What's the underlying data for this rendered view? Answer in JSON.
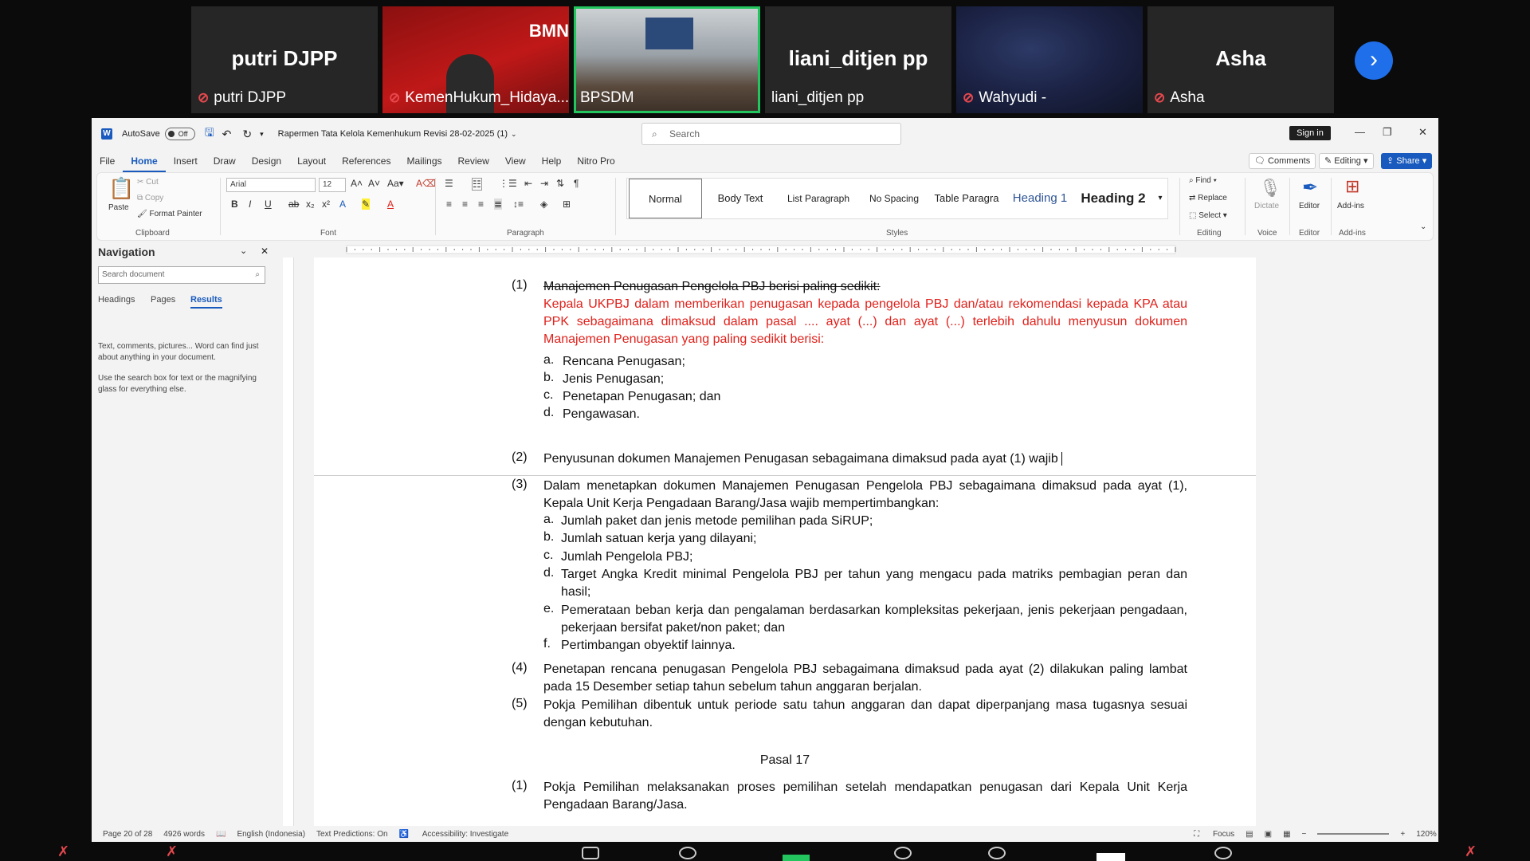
{
  "participants": [
    {
      "big_name": "putri DJPP",
      "caption": "putri DJPP",
      "muted": true,
      "kind": "name"
    },
    {
      "big_name": "",
      "caption": "KemenHukum_Hidaya...",
      "muted": true,
      "kind": "video-red",
      "overlay": "BMN"
    },
    {
      "big_name": "",
      "caption": "BPSDM",
      "muted": false,
      "kind": "video-room"
    },
    {
      "big_name": "liani_ditjen pp",
      "caption": "liani_ditjen pp",
      "muted": false,
      "kind": "name"
    },
    {
      "big_name": "",
      "caption": "Wahyudi -",
      "muted": true,
      "kind": "video-blur"
    },
    {
      "big_name": "Asha",
      "caption": "Asha",
      "muted": true,
      "kind": "name"
    }
  ],
  "titlebar": {
    "autosave": "AutoSave",
    "toggle": "Off",
    "doc_title": "Rapermen Tata Kelola Kemenhukum Revisi 28-02-2025 (1)",
    "search_placeholder": "Search",
    "signin": "Sign in"
  },
  "menu": [
    "File",
    "Home",
    "Insert",
    "Draw",
    "Design",
    "Layout",
    "References",
    "Mailings",
    "Review",
    "View",
    "Help",
    "Nitro Pro"
  ],
  "menu_right": {
    "comments": "Comments",
    "editing": "Editing",
    "share": "Share"
  },
  "ribbon": {
    "paste": "Paste",
    "cut": "Cut",
    "copy": "Copy",
    "format_painter": "Format Painter",
    "font_name": "Arial",
    "font_size": "12",
    "groups": {
      "clipboard": "Clipboard",
      "font": "Font",
      "paragraph": "Paragraph",
      "styles": "Styles",
      "editing": "Editing",
      "voice": "Voice",
      "editor": "Editor",
      "addins": "Add-ins"
    },
    "styles": [
      "Normal",
      "Body Text",
      "List Paragraph",
      "No Spacing",
      "Table Paragra",
      "Heading 1",
      "Heading 2"
    ],
    "find": "Find",
    "replace": "Replace",
    "select": "Select",
    "dictate": "Dictate",
    "editor": "Editor",
    "addins": "Add-ins"
  },
  "navigation": {
    "title": "Navigation",
    "search_placeholder": "Search document",
    "tabs": [
      "Headings",
      "Pages",
      "Results"
    ],
    "help1": "Text, comments, pictures... Word can find just about anything in your document.",
    "help2": "Use the search box for text or the magnifying glass for everything else."
  },
  "document": {
    "p1_num": "(1)",
    "p1_struck": "Manajemen Penugasan Pengelola PBJ berisi paling sedikit:",
    "p1_red": "Kepala UKPBJ dalam memberikan penugasan kepada pengelola PBJ dan/atau rekomendasi kepada KPA atau PPK sebagaimana dimaksud dalam pasal .... ayat (...) dan ayat (...)  terlebih dahulu menyusun dokumen Manajemen Penugasan yang paling sedikit berisi:",
    "list1": [
      {
        "m": "a.",
        "t": "Rencana Penugasan;"
      },
      {
        "m": "b.",
        "t": "Jenis Penugasan;"
      },
      {
        "m": "c.",
        "t": "Penetapan Penugasan; dan"
      },
      {
        "m": "d.",
        "t": "Pengawasan."
      }
    ],
    "p2_num": "(2)",
    "p2": "Penyusunan dokumen Manajemen Penugasan sebagaimana dimaksud pada ayat (1) wajib",
    "p3_num": "(3)",
    "p3": "Dalam menetapkan dokumen Manajemen Penugasan Pengelola PBJ sebagaimana dimaksud pada ayat (1), Kepala Unit Kerja Pengadaan Barang/Jasa wajib mempertimbangkan:",
    "list3": [
      {
        "m": "a.",
        "t": "Jumlah paket dan jenis metode pemilihan pada SiRUP;"
      },
      {
        "m": "b.",
        "t": "Jumlah satuan kerja yang dilayani;"
      },
      {
        "m": "c.",
        "t": "Jumlah Pengelola PBJ;"
      },
      {
        "m": "d.",
        "t": "Target Angka Kredit minimal Pengelola PBJ per tahun yang mengacu pada matriks pembagian peran dan hasil;"
      },
      {
        "m": "e.",
        "t": "Pemerataan beban kerja dan pengalaman berdasarkan kompleksitas pekerjaan, jenis pekerjaan pengadaan, pekerjaan bersifat paket/non paket; dan"
      },
      {
        "m": "f.",
        "t": "Pertimbangan obyektif lainnya."
      }
    ],
    "p4_num": "(4)",
    "p4": "Penetapan rencana penugasan Pengelola PBJ sebagaimana dimaksud pada ayat (2) dilakukan paling lambat pada 15 Desember setiap tahun sebelum tahun anggaran berjalan.",
    "p5_num": "(5)",
    "p5": "Pokja Pemilihan dibentuk untuk periode satu tahun anggaran dan dapat diperpanjang masa tugasnya sesuai dengan kebutuhan.",
    "pasal": "Pasal 17",
    "q1_num": "(1)",
    "q1": "Pokja Pemilihan melaksanakan proses pemilihan setelah mendapatkan penugasan dari Kepala Unit Kerja Pengadaan Barang/Jasa."
  },
  "status": {
    "page": "Page 20 of 28",
    "words": "4926 words",
    "lang": "English (Indonesia)",
    "predictions": "Text Predictions: On",
    "accessibility": "Accessibility: Investigate",
    "focus": "Focus",
    "zoom": "120%"
  }
}
